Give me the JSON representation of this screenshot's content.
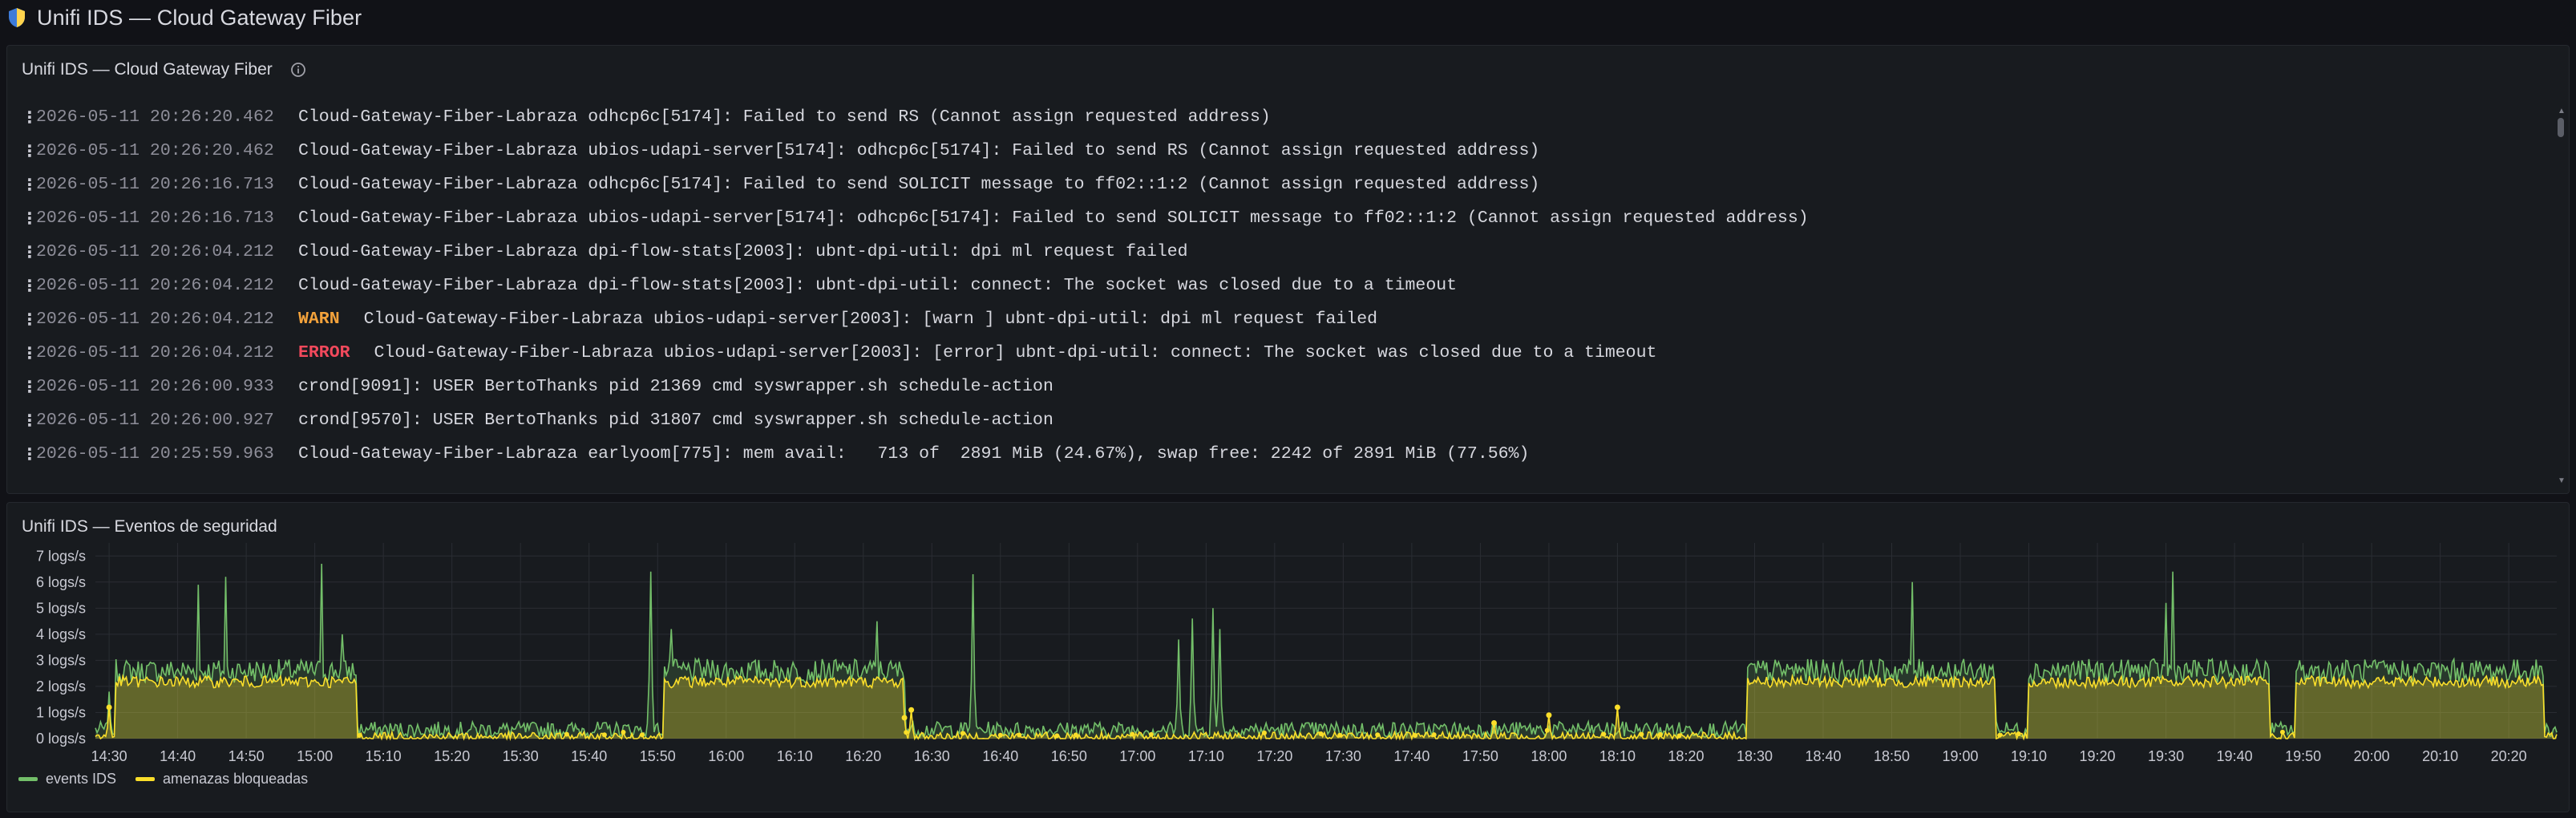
{
  "page": {
    "title": "Unifi IDS — Cloud Gateway Fiber"
  },
  "colors": {
    "green": "#73bf69",
    "yellow": "#fade2a",
    "warn": "#f3a23b",
    "error": "#f2495c"
  },
  "logs_panel": {
    "title": "Unifi IDS — Cloud Gateway Fiber",
    "rows": [
      {
        "ts": "2026-05-11 20:26:20.462",
        "level": "",
        "msg": "Cloud-Gateway-Fiber-Labraza odhcp6c[5174]: Failed to send RS (Cannot assign requested address)"
      },
      {
        "ts": "2026-05-11 20:26:20.462",
        "level": "",
        "msg": "Cloud-Gateway-Fiber-Labraza ubios-udapi-server[5174]: odhcp6c[5174]: Failed to send RS (Cannot assign requested address)"
      },
      {
        "ts": "2026-05-11 20:26:16.713",
        "level": "",
        "msg": "Cloud-Gateway-Fiber-Labraza odhcp6c[5174]: Failed to send SOLICIT message to ff02::1:2 (Cannot assign requested address)"
      },
      {
        "ts": "2026-05-11 20:26:16.713",
        "level": "",
        "msg": "Cloud-Gateway-Fiber-Labraza ubios-udapi-server[5174]: odhcp6c[5174]: Failed to send SOLICIT message to ff02::1:2 (Cannot assign requested address)"
      },
      {
        "ts": "2026-05-11 20:26:04.212",
        "level": "",
        "msg": "Cloud-Gateway-Fiber-Labraza dpi-flow-stats[2003]: ubnt-dpi-util: dpi ml request failed"
      },
      {
        "ts": "2026-05-11 20:26:04.212",
        "level": "",
        "msg": "Cloud-Gateway-Fiber-Labraza dpi-flow-stats[2003]: ubnt-dpi-util: connect: The socket was closed due to a timeout"
      },
      {
        "ts": "2026-05-11 20:26:04.212",
        "level": "WARN",
        "msg": "Cloud-Gateway-Fiber-Labraza ubios-udapi-server[2003]: [warn ] ubnt-dpi-util: dpi ml request failed"
      },
      {
        "ts": "2026-05-11 20:26:04.212",
        "level": "ERROR",
        "msg": "Cloud-Gateway-Fiber-Labraza ubios-udapi-server[2003]: [error] ubnt-dpi-util: connect: The socket was closed due to a timeout"
      },
      {
        "ts": "2026-05-11 20:26:00.933",
        "level": "",
        "msg": "crond[9091]: USER BertoThanks pid 21369 cmd syswrapper.sh schedule-action"
      },
      {
        "ts": "2026-05-11 20:26:00.927",
        "level": "",
        "msg": "crond[9570]: USER BertoThanks pid 31807 cmd syswrapper.sh schedule-action"
      },
      {
        "ts": "2026-05-11 20:25:59.963",
        "level": "",
        "msg": "Cloud-Gateway-Fiber-Labraza earlyoom[775]: mem avail:   713 of  2891 MiB (24.67%), swap free: 2242 of 2891 MiB (77.56%)"
      }
    ]
  },
  "timeseries_panel": {
    "title": "Unifi IDS — Eventos de seguridad",
    "legend": [
      {
        "name": "events IDS",
        "color": "#73bf69"
      },
      {
        "name": "amenazas bloqueadas",
        "color": "#fade2a"
      }
    ]
  },
  "chart_data": {
    "type": "line",
    "ylim": [
      0,
      7.5
    ],
    "y_ticks": [
      "0 logs/s",
      "1 logs/s",
      "2 logs/s",
      "3 logs/s",
      "4 logs/s",
      "5 logs/s",
      "6 logs/s",
      "7 logs/s"
    ],
    "x_ticks": [
      "14:30",
      "14:40",
      "14:50",
      "15:00",
      "15:10",
      "15:20",
      "15:30",
      "15:40",
      "15:50",
      "16:00",
      "16:10",
      "16:20",
      "16:30",
      "16:40",
      "16:50",
      "17:00",
      "17:10",
      "17:20",
      "17:30",
      "17:40",
      "17:50",
      "18:00",
      "18:10",
      "18:20",
      "18:30",
      "18:40",
      "18:50",
      "19:00",
      "19:10",
      "19:20",
      "19:30",
      "19:40",
      "19:50",
      "20:00",
      "20:10",
      "20:20"
    ],
    "x_range": [
      "14:28",
      "20:27"
    ],
    "grid": true,
    "legend_position": "bottom-left",
    "series": [
      {
        "name": "events IDS",
        "color": "#73bf69",
        "baseline_level": 0.2,
        "high_level": 2.4,
        "high_periods": [
          [
            "14:31",
            "15:06"
          ],
          [
            "15:51",
            "16:26"
          ],
          [
            "18:29",
            "19:05"
          ],
          [
            "19:10",
            "19:45"
          ],
          [
            "19:49",
            "20:25"
          ]
        ],
        "peaks": [
          [
            "14:30",
            1.8
          ],
          [
            "14:43",
            5.9
          ],
          [
            "14:47",
            6.2
          ],
          [
            "15:01",
            6.7
          ],
          [
            "15:04",
            4.0
          ],
          [
            "15:49",
            6.4
          ],
          [
            "16:22",
            4.5
          ],
          [
            "16:36",
            6.3
          ],
          [
            "17:06",
            3.8
          ],
          [
            "17:08",
            4.6
          ],
          [
            "17:11",
            5.0
          ],
          [
            "17:12",
            4.2
          ],
          [
            "18:53",
            6.0
          ],
          [
            "19:31",
            6.4
          ],
          [
            "19:30",
            5.2
          ],
          [
            "19:05",
            2.2
          ],
          [
            "15:52",
            4.2
          ]
        ]
      },
      {
        "name": "amenazas bloqueadas",
        "color": "#fade2a",
        "baseline_level": 0.05,
        "high_level": 2.2,
        "high_periods": [
          [
            "14:31",
            "15:06"
          ],
          [
            "15:51",
            "16:26"
          ],
          [
            "18:29",
            "19:05"
          ],
          [
            "19:10",
            "19:45"
          ],
          [
            "19:49",
            "20:25"
          ]
        ],
        "peaks": [
          [
            "16:27",
            1.1
          ],
          [
            "17:52",
            0.6
          ],
          [
            "18:10",
            1.2
          ],
          [
            "18:00",
            0.9
          ],
          [
            "16:26",
            0.8
          ],
          [
            "14:30",
            1.2
          ]
        ]
      }
    ]
  }
}
